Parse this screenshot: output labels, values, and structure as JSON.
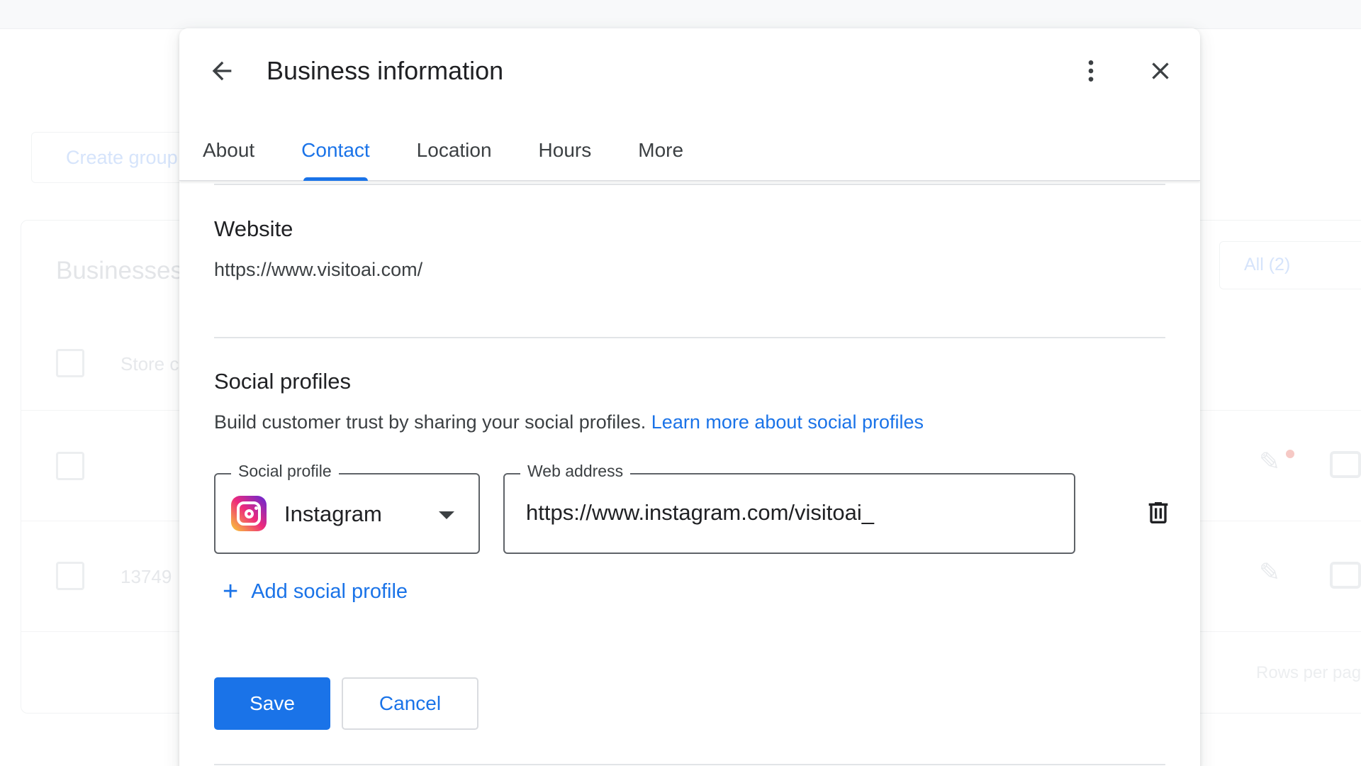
{
  "background": {
    "create_group_label": "Create group",
    "businesses_title": "Businesses",
    "filter_all_label": "All (2)",
    "row_header_label": "Store code",
    "row2_value": "13749",
    "rows_per_page_label": "Rows per page"
  },
  "dialog": {
    "title": "Business information",
    "tabs": [
      {
        "label": "About",
        "active": false
      },
      {
        "label": "Contact",
        "active": true
      },
      {
        "label": "Location",
        "active": false
      },
      {
        "label": "Hours",
        "active": false
      },
      {
        "label": "More",
        "active": false
      }
    ],
    "website": {
      "title": "Website",
      "value": "https://www.visitoai.com/"
    },
    "social": {
      "title": "Social profiles",
      "helper_text": "Build customer trust by sharing your social profiles.",
      "learn_more_link": "Learn more about social profiles",
      "profile_label": "Social profile",
      "profile_value": "Instagram",
      "address_label": "Web address",
      "address_value": "https://www.instagram.com/visitoai_",
      "add_label": "Add social profile"
    },
    "actions": {
      "save_label": "Save",
      "cancel_label": "Cancel"
    }
  },
  "colors": {
    "accent": "#1a73e8",
    "text_primary": "#202124",
    "text_secondary": "#3c4043"
  },
  "icons": {
    "back": "arrow-left-icon",
    "more": "more-vert-icon",
    "close": "close-icon",
    "instagram": "instagram-icon",
    "dropdown": "caret-down-icon",
    "delete": "trash-icon",
    "add": "plus-icon"
  }
}
